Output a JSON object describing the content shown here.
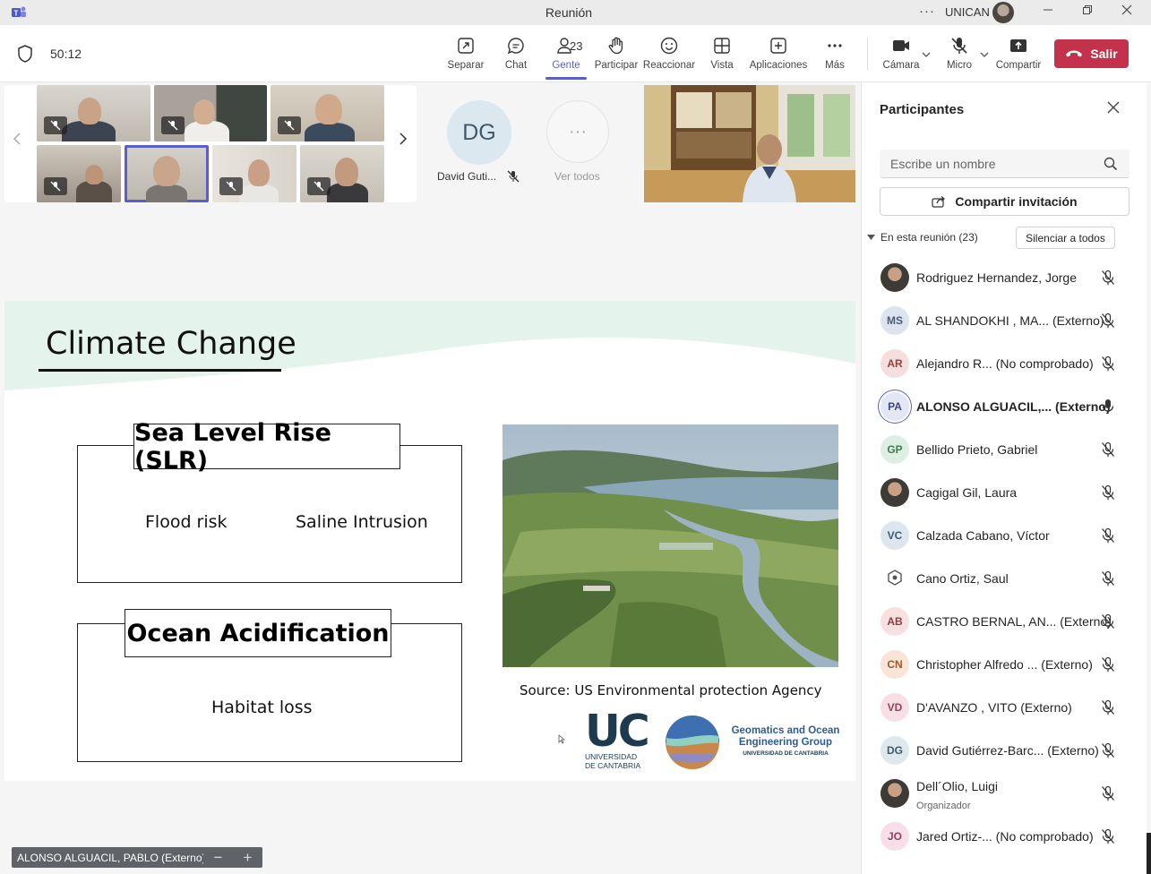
{
  "window": {
    "title": "Reunión",
    "org": "UNICAN",
    "more_glyph": "···"
  },
  "toolbar": {
    "timer": "50:12",
    "tools": [
      {
        "label": "Separar",
        "icon": "pop-out-icon"
      },
      {
        "label": "Chat",
        "icon": "chat-icon"
      },
      {
        "label": "Gente",
        "icon": "people-icon",
        "count": "23"
      },
      {
        "label": "Participar",
        "icon": "raise-hand-icon"
      },
      {
        "label": "Reaccionar",
        "icon": "smile-icon"
      },
      {
        "label": "Vista",
        "icon": "grid-icon"
      },
      {
        "label": "Aplicaciones",
        "icon": "add-app-icon"
      },
      {
        "label": "Más",
        "icon": "more-icon"
      },
      {
        "label": "Cámara",
        "icon": "camera-icon"
      },
      {
        "label": "Micro",
        "icon": "mic-off-icon"
      },
      {
        "label": "Compartir",
        "icon": "share-screen-icon"
      }
    ],
    "leave_label": "Salir",
    "accent": "#5b5fc7",
    "leave_color": "#c4314b"
  },
  "stage": {
    "dg_initials": "DG",
    "dg_name": "David Guti...",
    "more_label": "Ver todos",
    "more_glyph": "···"
  },
  "slide": {
    "title": "Climate Change",
    "box1_title": "Sea Level Rise (SLR)",
    "box1_item1": "Flood risk",
    "box1_item2": "Saline Intrusion",
    "box2_title": "Ocean Acidification",
    "box2_item1": "Habitat loss",
    "source": "Source: US Environmental protection Agency",
    "uc_letters": "UC",
    "uc_sub1": "UNIVERSIDAD",
    "uc_sub2": "DE CANTABRIA",
    "goe_title": "Geomatics and Ocean Engineering Group",
    "goe_sub": "UNIVERSIDAD DE CANTABRIA"
  },
  "presenter_tag": "ALONSO ALGUACIL, PABLO (Externo)",
  "zoom": {
    "minus": "−",
    "plus": "+"
  },
  "panel": {
    "title": "Participantes",
    "search_placeholder": "Escribe un nombre",
    "share_label": "Compartir invitación",
    "in_meeting": "En esta reunión (23)",
    "mute_all": "Silenciar a todos",
    "participants": [
      {
        "name": "Rodriguez Hernandez, Jorge",
        "initials": "",
        "photo": true,
        "mic": "off"
      },
      {
        "name": "AL SHANDOKHI , MA... (Externo)",
        "initials": "MS",
        "bg": "#dde4ef",
        "fg": "#4a5a78",
        "mic": "off"
      },
      {
        "name": "Alejandro R... (No comprobado)",
        "initials": "AR",
        "bg": "#f5dede",
        "fg": "#9a4040",
        "mic": "off"
      },
      {
        "name": "ALONSO ALGUACIL,... (Externo)",
        "initials": "PA",
        "bg": "#e3e6f3",
        "fg": "#3c4a86",
        "mic": "on",
        "bold": true
      },
      {
        "name": "Bellido Prieto, Gabriel",
        "initials": "GP",
        "bg": "#ddefe3",
        "fg": "#3f7a50",
        "mic": "off"
      },
      {
        "name": "Cagigal Gil, Laura",
        "initials": "",
        "photo": true,
        "mic": "off"
      },
      {
        "name": "Calzada Cabano, Víctor",
        "initials": "VC",
        "bg": "#dde6ef",
        "fg": "#3c5a78",
        "mic": "off"
      },
      {
        "name": "Cano Ortiz, Saul",
        "initials": "",
        "logo": true,
        "mic": "off"
      },
      {
        "name": "CASTRO BERNAL, AN... (Externo)",
        "initials": "AB",
        "bg": "#f6e0e0",
        "fg": "#8f3e3e",
        "mic": "off"
      },
      {
        "name": "Christopher Alfredo ... (Externo)",
        "initials": "CN",
        "bg": "#f8e5d8",
        "fg": "#a0572a",
        "mic": "off"
      },
      {
        "name": "D'AVANZO , VITO (Externo)",
        "initials": "VD",
        "bg": "#f6dfe5",
        "fg": "#96405a",
        "mic": "off"
      },
      {
        "name": "David Gutiérrez-Barc... (Externo)",
        "initials": "DG",
        "bg": "#dde9ef",
        "fg": "#41586c",
        "mic": "off"
      },
      {
        "name": "Dell´Olio, Luigi",
        "role": "Organizador",
        "initials": "",
        "photo": true,
        "mic": "off"
      },
      {
        "name": "Jared Ortiz-... (No comprobado)",
        "initials": "JO",
        "bg": "#f6dfe8",
        "fg": "#94405e",
        "mic": "off"
      }
    ]
  }
}
